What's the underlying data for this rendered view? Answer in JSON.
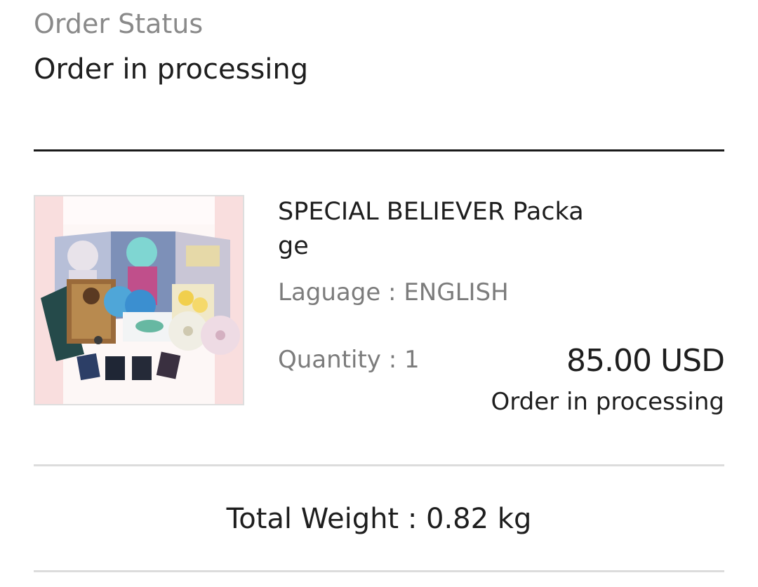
{
  "order_status": {
    "label": "Order Status",
    "value": "Order in processing"
  },
  "item": {
    "image_icon": "product-package-image",
    "name": "SPECIAL BELIEVER Package",
    "language": "Laguage : ENGLISH",
    "quantity": "Quantity : 1",
    "price": "85.00 USD",
    "status": "Order in processing"
  },
  "summary": {
    "total_weight": "Total Weight : 0.82 kg"
  },
  "colors": {
    "label_gray": "#8a8a8a",
    "text_dark": "#1e1e1e",
    "divider_dark": "#1a1a1a",
    "divider_light": "#dcdcdc"
  }
}
